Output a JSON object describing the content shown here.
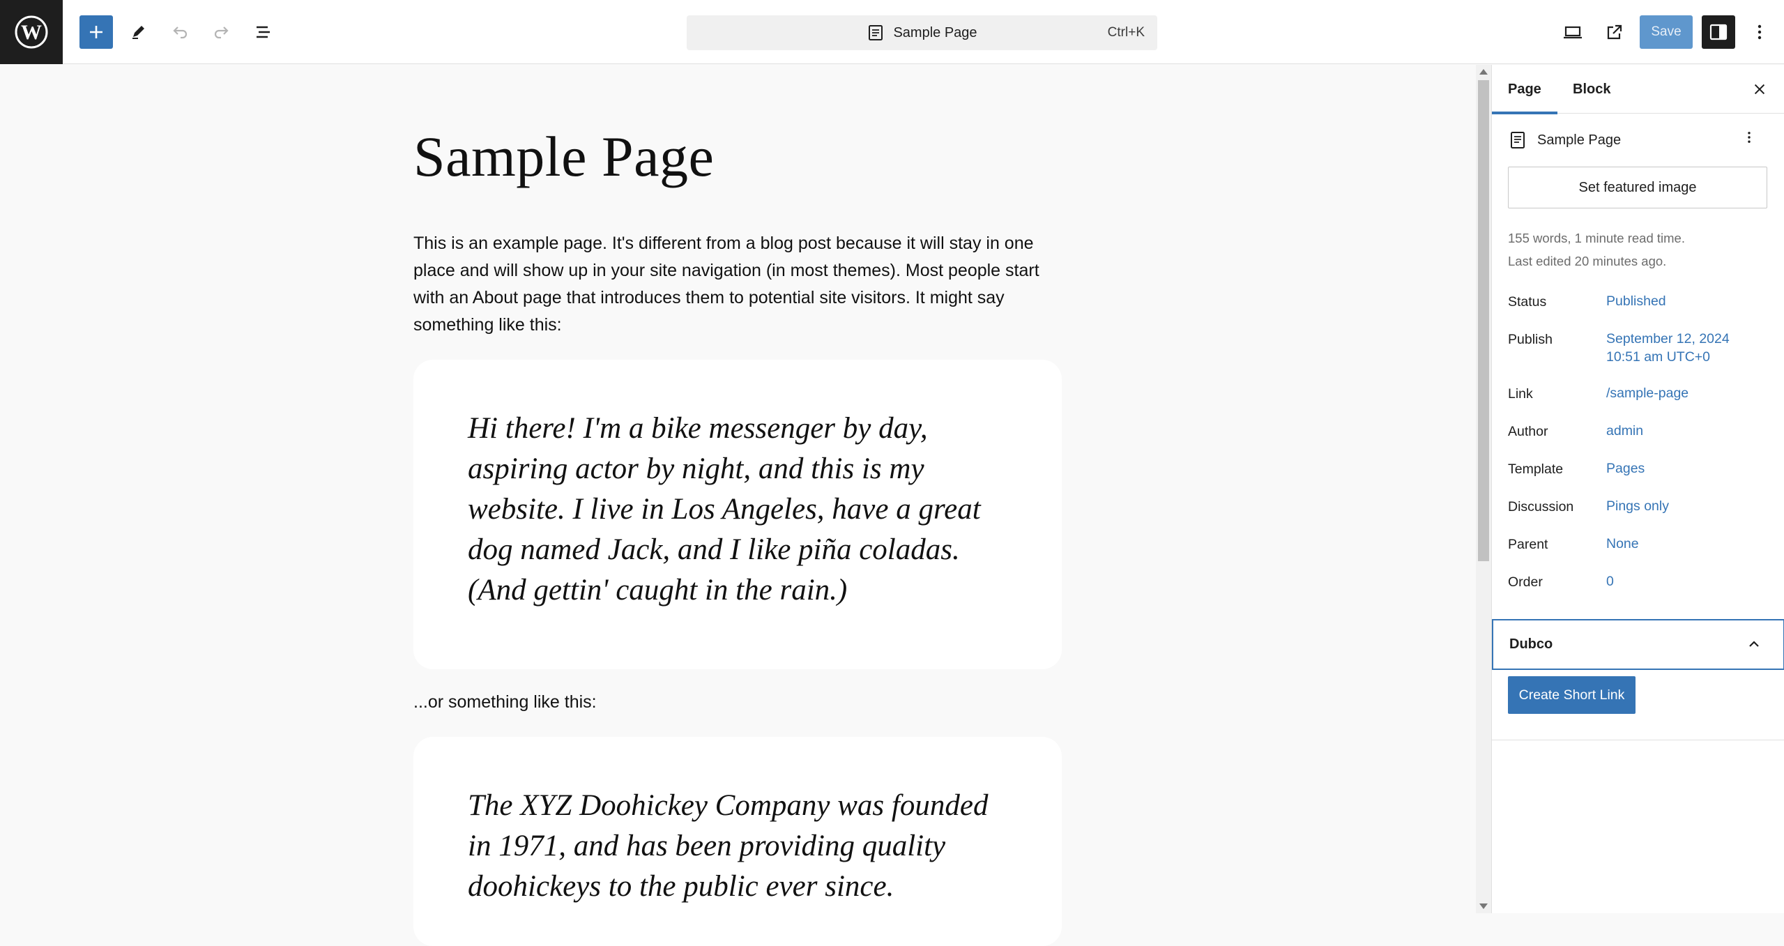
{
  "toolbar": {
    "logo": "wordpress-logo",
    "add_icon": "plus-icon",
    "tools_icon": "pencil-icon",
    "undo_icon": "undo-icon",
    "redo_icon": "redo-icon",
    "list_view_icon": "list-view-icon",
    "document_title": "Sample Page",
    "shortcut": "Ctrl+K",
    "view_icon": "desktop-icon",
    "preview_icon": "external-link-icon",
    "save_label": "Save",
    "settings_icon": "sidebar-toggle-icon",
    "options_icon": "kebab-icon"
  },
  "content": {
    "title": "Sample Page",
    "intro": "This is an example page. It's different from a blog post because it will stay in one place and will show up in your site navigation (in most themes). Most people start with an About page that introduces them to potential site visitors. It might say something like this:",
    "quote1": "Hi there! I'm a bike messenger by day, aspiring actor by night, and this is my website. I live in Los Angeles, have a great dog named Jack, and I like piña coladas. (And gettin' caught in the rain.)",
    "bridge": "...or something like this:",
    "quote2": "The XYZ Doohickey Company was founded in 1971, and has been providing quality doohickeys to the public ever since."
  },
  "sidebar": {
    "tabs": [
      {
        "label": "Page"
      },
      {
        "label": "Block"
      }
    ],
    "page_name": "Sample Page",
    "featured_image_label": "Set featured image",
    "word_count": "155 words, 1 minute read time.",
    "last_edited": "Last edited 20 minutes ago.",
    "rows": [
      {
        "label": "Status",
        "value": "Published"
      },
      {
        "label": "Publish",
        "value": "September 12, 2024",
        "value2": "10:51 am UTC+0"
      },
      {
        "label": "Link",
        "value": "/sample-page"
      },
      {
        "label": "Author",
        "value": "admin"
      },
      {
        "label": "Template",
        "value": "Pages"
      },
      {
        "label": "Discussion",
        "value": "Pings only"
      },
      {
        "label": "Parent",
        "value": "None"
      },
      {
        "label": "Order",
        "value": "0"
      }
    ],
    "dubco_title": "Dubco",
    "short_link_label": "Create Short Link"
  },
  "colors": {
    "accent": "#3574b5",
    "save_disabled": "#5f97cd",
    "dark": "#1e1e1e"
  }
}
